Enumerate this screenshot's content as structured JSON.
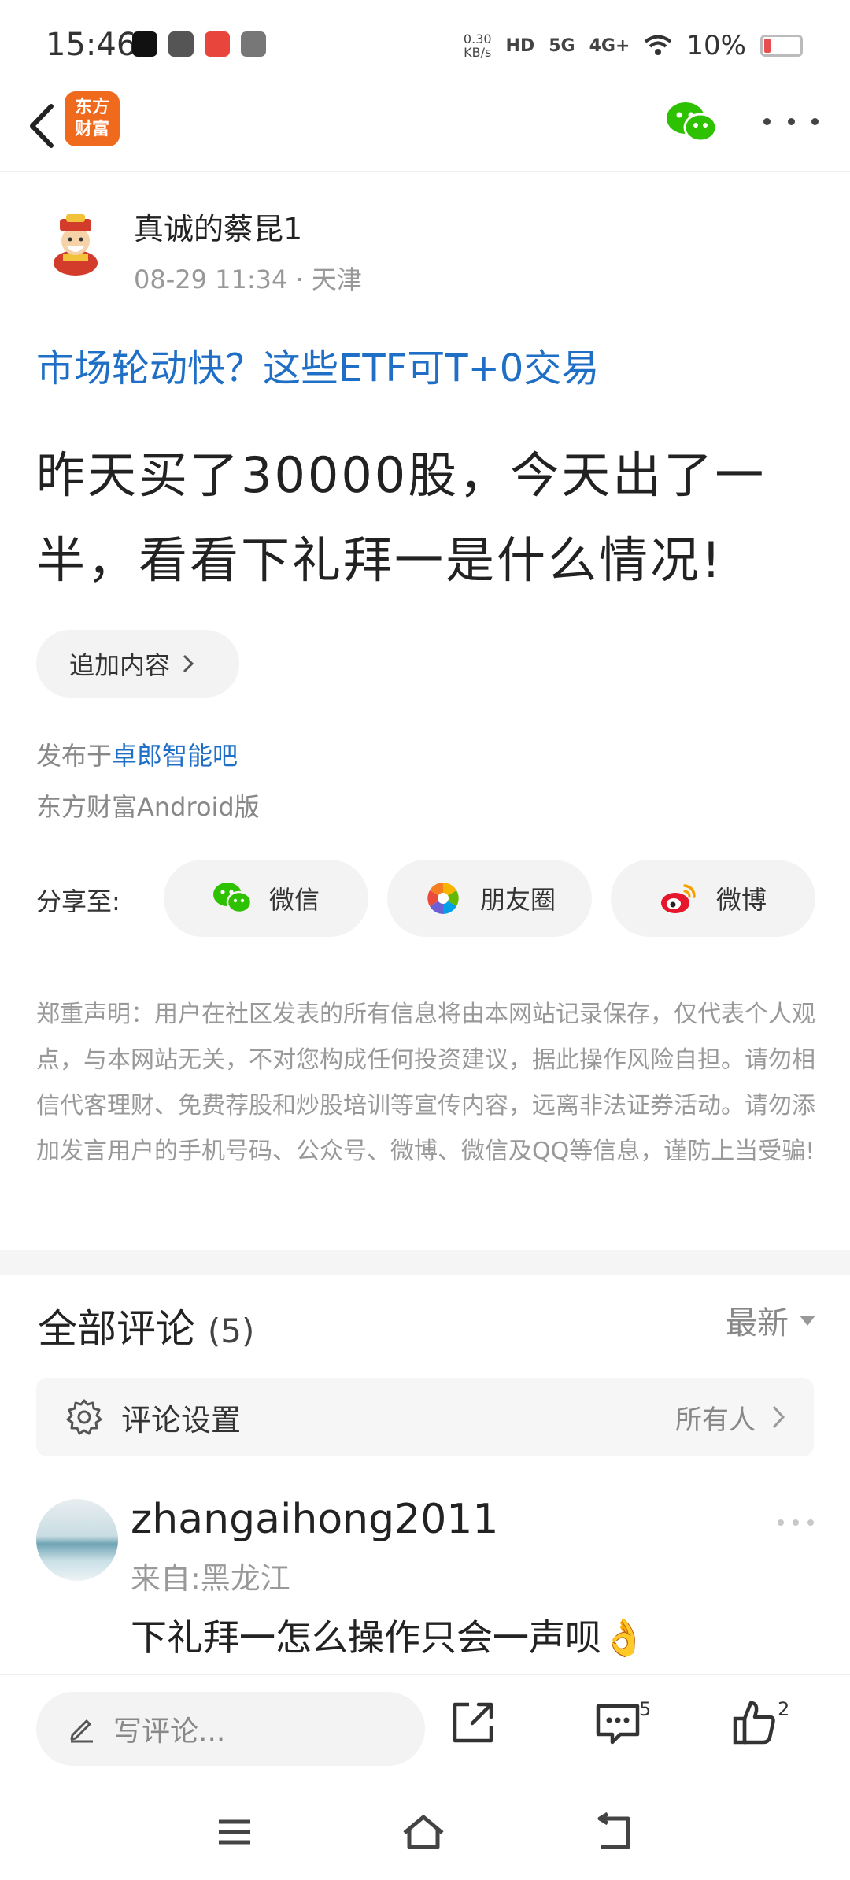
{
  "status_bar": {
    "time": "15:46",
    "network_speed": "0.30",
    "network_unit": "KB/s",
    "hd_label": "HD",
    "net_5g": "5G",
    "net_4g": "4G+",
    "battery_text": "10%"
  },
  "top_nav": {
    "logo_text_1": "东方",
    "logo_text_2": "财富"
  },
  "post": {
    "author_name": "真诚的蔡昆1",
    "post_date": "08-29 11:34",
    "location": "天津",
    "promo_link": "市场轮动快？这些ETF可T+0交易",
    "body": "昨天买了30000股，今天出了一半，看看下礼拜一是什么情况!",
    "append_label": "追加内容",
    "posted_in_prefix": "发布于",
    "posted_in_bar": "卓郎智能吧",
    "client": "东方财富Android版"
  },
  "share": {
    "label": "分享至:",
    "wechat": "微信",
    "moments": "朋友圈",
    "weibo": "微博"
  },
  "disclaimer": "郑重声明：用户在社区发表的所有信息将由本网站记录保存，仅代表个人观点，与本网站无关，不对您构成任何投资建议，据此操作风险自担。请勿相信代客理财、免费荐股和炒股培训等宣传内容，远离非法证券活动。请勿添加发言用户的手机号码、公众号、微博、微信及QQ等信息，谨防上当受骗!",
  "comments": {
    "title": "全部评论",
    "count": "(5)",
    "sort": "最新",
    "settings_label": "评论设置",
    "settings_value": "所有人",
    "items": [
      {
        "user": "zhangaihong2011",
        "from": "来自:黑龙江",
        "text": "下礼拜一怎么操作只会一声呗👌"
      }
    ]
  },
  "bottom_bar": {
    "write_placeholder": "写评论...",
    "comment_count": "5",
    "like_count": "2"
  },
  "colors": {
    "brand_orange": "#f06a1e",
    "link_blue": "#1f6fc6",
    "wechat_green": "#2dc100",
    "weibo_red": "#e6162d"
  }
}
